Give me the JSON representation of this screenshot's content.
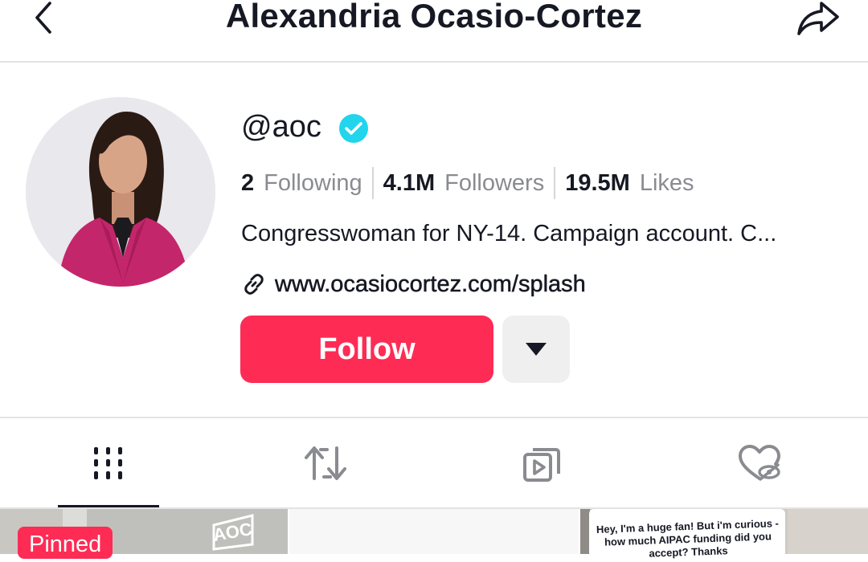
{
  "header": {
    "title": "Alexandria Ocasio-Cortez",
    "back_icon": "chevron-left-icon",
    "share_icon": "share-arrow-icon"
  },
  "profile": {
    "username": "@aoc",
    "verified_icon": "verified-badge-icon",
    "stats": {
      "following_count": "2",
      "following_label": "Following",
      "followers_count": "4.1M",
      "followers_label": "Followers",
      "likes_count": "19.5M",
      "likes_label": "Likes"
    },
    "bio": "Congresswoman for NY-14. Campaign account. C...",
    "link_icon": "link-icon",
    "link": "www.ocasiocortez.com/splash",
    "follow_label": "Follow",
    "more_icon": "caret-down-icon"
  },
  "tabs": [
    {
      "icon": "videos-grid-icon",
      "active": true
    },
    {
      "icon": "repost-icon",
      "active": false
    },
    {
      "icon": "playlist-icon",
      "active": false
    },
    {
      "icon": "liked-hidden-icon",
      "active": false
    }
  ],
  "videos": [
    {
      "badge": "Pinned",
      "logo_text": "AOC"
    },
    {},
    {
      "caption": "Hey, I'm a huge fan! But i'm curious - how much AIPAC funding did you accept? Thanks"
    }
  ],
  "colors": {
    "accent": "#fe2c55",
    "verified": "#20d5ec",
    "text_primary": "#161823",
    "text_secondary": "#8a8b91"
  }
}
